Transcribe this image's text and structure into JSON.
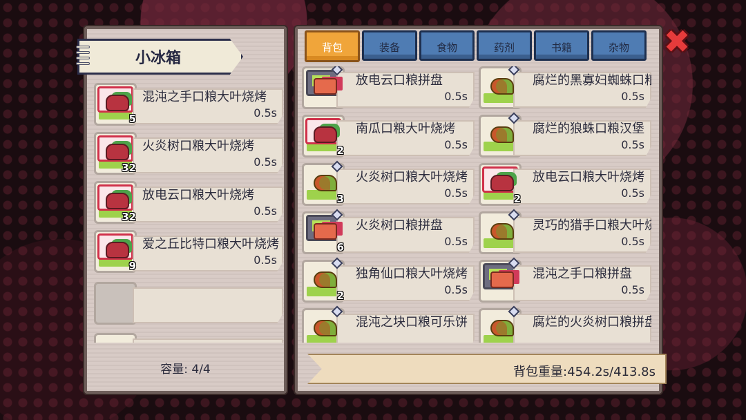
{
  "fridge": {
    "title": "小冰箱",
    "capacity_label": "容量: 4/4",
    "items": [
      {
        "name": "混沌之手口粮大叶烧烤",
        "weight": "0.5s",
        "count": "5",
        "icon": "steak"
      },
      {
        "name": "火炎树口粮大叶烧烤",
        "weight": "0.5s",
        "count": "32",
        "icon": "steak"
      },
      {
        "name": "放电云口粮大叶烧烤",
        "weight": "0.5s",
        "count": "32",
        "icon": "steak"
      },
      {
        "name": "爱之丘比特口粮大叶烧烤",
        "weight": "0.5s",
        "count": "9",
        "icon": "steak"
      }
    ]
  },
  "backpack": {
    "tabs": [
      "背包",
      "装备",
      "食物",
      "药剂",
      "书籍",
      "杂物"
    ],
    "active_tab": "背包",
    "weight_label": "背包重量:454.2s/413.8s",
    "items": [
      {
        "name": "放电云口粮拼盘",
        "weight": "0.5s",
        "count": "",
        "icon": "plate",
        "frame": "dark"
      },
      {
        "name": "腐烂的黑寡妇蜘蛛口粮",
        "weight": "0.5s",
        "count": "",
        "icon": "leaf",
        "frame": "green"
      },
      {
        "name": "南瓜口粮大叶烧烤",
        "weight": "0.5s",
        "count": "2",
        "icon": "steak",
        "frame": "pink"
      },
      {
        "name": "腐烂的狼蛛口粮汉堡",
        "weight": "0.5s",
        "count": "",
        "icon": "leaf",
        "frame": "green"
      },
      {
        "name": "火炎树口粮大叶烧烤",
        "weight": "0.5s",
        "count": "3",
        "icon": "leaf",
        "frame": "green"
      },
      {
        "name": "放电云口粮大叶烧烤",
        "weight": "0.5s",
        "count": "2",
        "icon": "steak",
        "frame": "pink"
      },
      {
        "name": "火炎树口粮拼盘",
        "weight": "0.5s",
        "count": "6",
        "icon": "plate",
        "frame": "dark"
      },
      {
        "name": "灵巧的猎手口粮大叶烧烤",
        "weight": "0.5s",
        "count": "",
        "icon": "leaf",
        "frame": "green"
      },
      {
        "name": "独角仙口粮大叶烧烤",
        "weight": "0.5s",
        "count": "2",
        "icon": "leaf",
        "frame": "green"
      },
      {
        "name": "混沌之手口粮拼盘",
        "weight": "0.5s",
        "count": "",
        "icon": "plate",
        "frame": "dark"
      },
      {
        "name": "混沌之块口粮可乐饼",
        "weight": "",
        "count": "",
        "icon": "leaf",
        "frame": "green"
      },
      {
        "name": "腐烂的火炎树口粮拼盘",
        "weight": "",
        "count": "",
        "icon": "leaf",
        "frame": "green"
      }
    ]
  }
}
